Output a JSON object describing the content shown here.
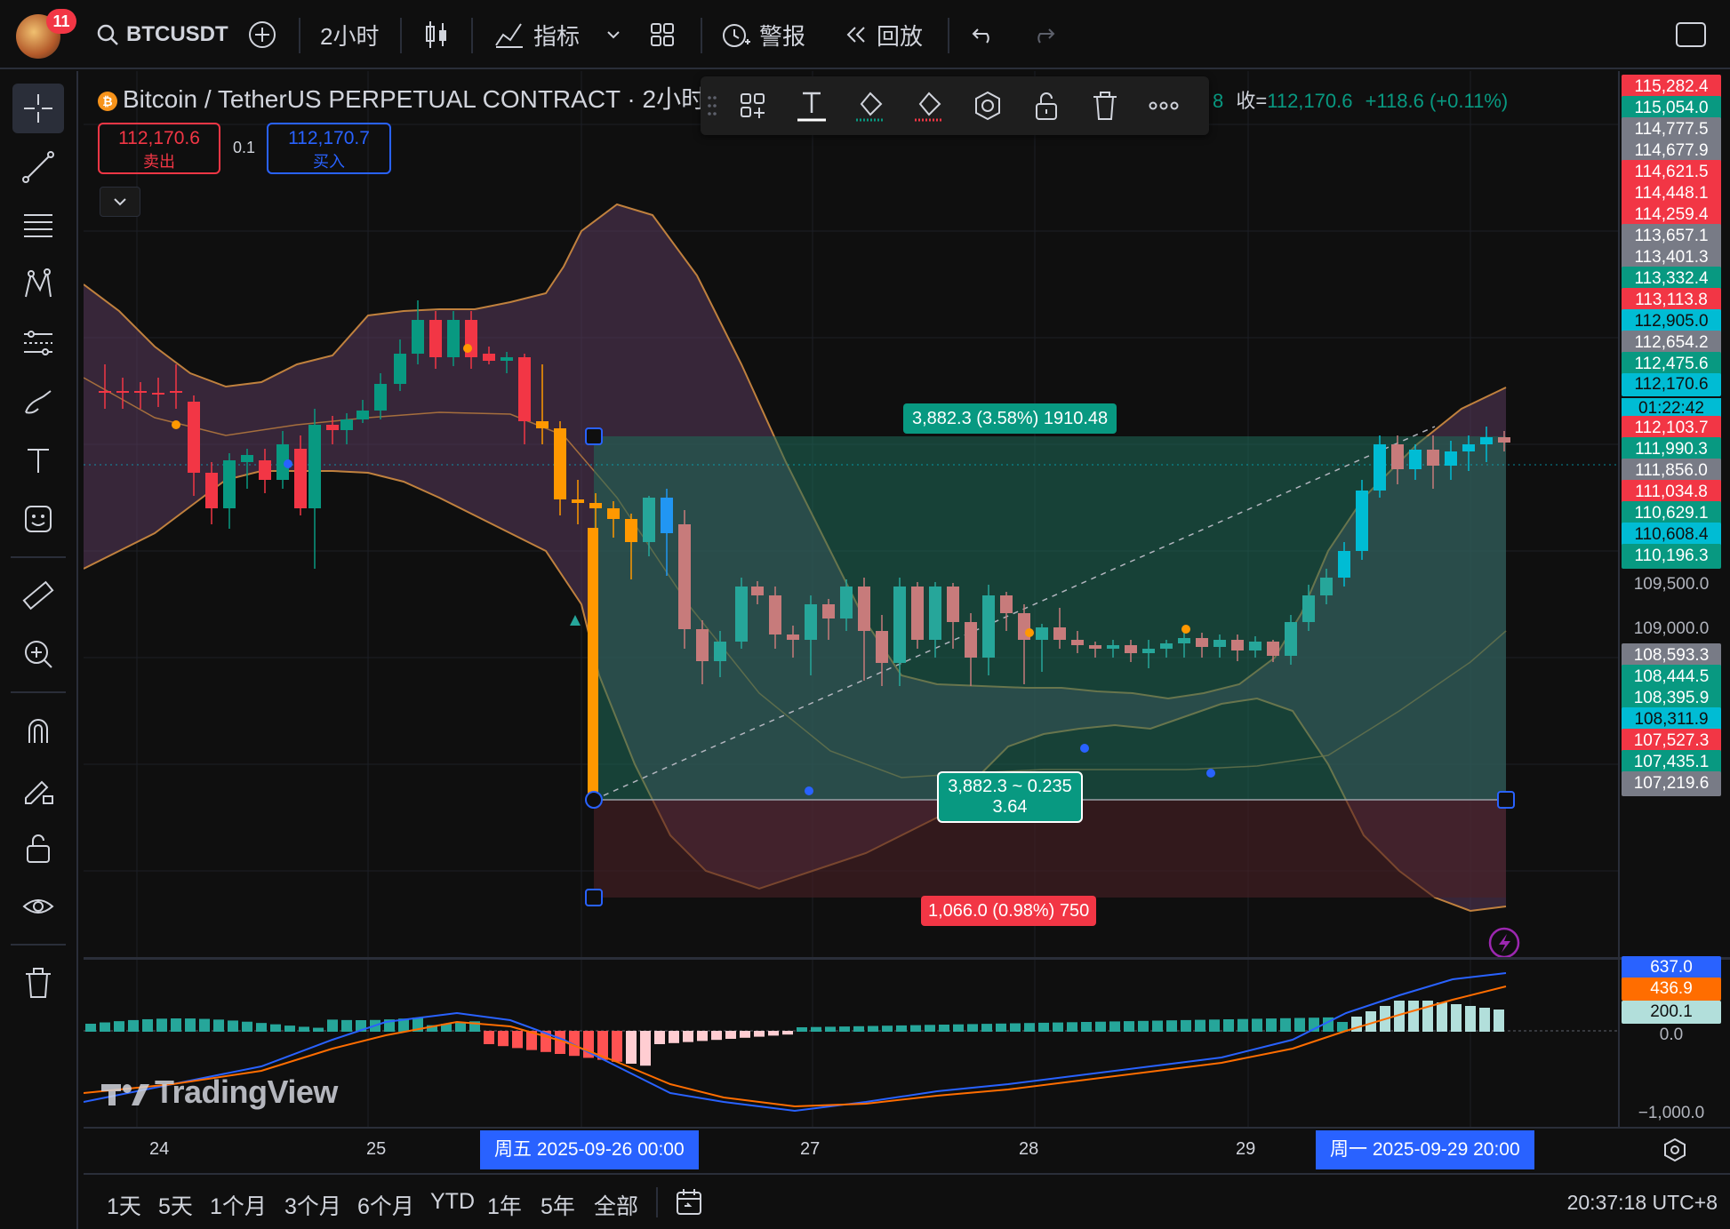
{
  "topbar": {
    "avatar_badge": "11",
    "symbol": "BTCUSDT",
    "interval": "2小时",
    "indicators": "指标",
    "alerts": "警报",
    "replay": "回放"
  },
  "header": {
    "title": "Bitcoin / TetherUS PERPETUAL CONTRACT · 2小时 ·",
    "btc_glyph": "₿",
    "sell_price": "112,170.6",
    "sell_label": "卖出",
    "spread": "0.1",
    "buy_price": "112,170.7",
    "buy_label": "买入",
    "ohlc_prefix": "8",
    "close_key": "收=",
    "close_value": "112,170.6",
    "change": "+118.6 (+0.11%)"
  },
  "position": {
    "target_label": "3,882.3 (3.58%) 1910.48",
    "center_label_line1": "3,882.3 ~ 0.235",
    "center_label_line2": "3.64",
    "stop_label": "1,066.0 (0.98%) 750"
  },
  "price_axis": [
    {
      "text": "115,282.4",
      "style": "red"
    },
    {
      "text": "115,054.0",
      "style": "green"
    },
    {
      "text": "114,777.5",
      "style": "gray"
    },
    {
      "text": "114,677.9",
      "style": "gray"
    },
    {
      "text": "114,621.5",
      "style": "red"
    },
    {
      "text": "114,448.1",
      "style": "red"
    },
    {
      "text": "114,259.4",
      "style": "red"
    },
    {
      "text": "113,657.1",
      "style": "gray"
    },
    {
      "text": "113,401.3",
      "style": "gray"
    },
    {
      "text": "113,332.4",
      "style": "green"
    },
    {
      "text": "113,113.8",
      "style": "red"
    },
    {
      "text": "112,905.0",
      "style": "cyan"
    },
    {
      "text": "112,654.2",
      "style": "gray"
    },
    {
      "text": "112,475.6",
      "style": "green"
    },
    {
      "text": "112,170.6",
      "style": "cyan"
    },
    {
      "text": "01:22:42",
      "style": "cyan"
    },
    {
      "text": "112,103.7",
      "style": "red"
    },
    {
      "text": "111,990.3",
      "style": "green"
    },
    {
      "text": "111,856.0",
      "style": "gray"
    },
    {
      "text": "111,034.8",
      "style": "red"
    },
    {
      "text": "110,629.1",
      "style": "green"
    },
    {
      "text": "110,608.4",
      "style": "cyan"
    },
    {
      "text": "110,196.3",
      "style": "green"
    },
    {
      "text": "109,500.0",
      "style": "plain"
    },
    {
      "text": "109,000.0",
      "style": "plain"
    },
    {
      "text": "108,593.3",
      "style": "gray"
    },
    {
      "text": "108,444.5",
      "style": "green"
    },
    {
      "text": "108,395.9",
      "style": "green"
    },
    {
      "text": "108,311.9",
      "style": "cyan"
    },
    {
      "text": "107,527.3",
      "style": "red"
    },
    {
      "text": "107,435.1",
      "style": "green"
    },
    {
      "text": "107,219.6",
      "style": "gray"
    }
  ],
  "macd_axis": [
    {
      "text": "637.0",
      "style": "blue"
    },
    {
      "text": "436.9",
      "style": "orange"
    },
    {
      "text": "200.1",
      "style": "mint"
    },
    {
      "text": "0.0",
      "style": "plain"
    },
    {
      "text": "−1,000.0",
      "style": "plain"
    }
  ],
  "time_axis": {
    "labels": [
      "24",
      "25",
      "27",
      "28",
      "29"
    ],
    "chip_start": "周五 2025-09-26   00:00",
    "chip_end": "周一 2025-09-29   20:00"
  },
  "range_bar": {
    "items": [
      "1天",
      "5天",
      "1个月",
      "3个月",
      "6个月",
      "YTD",
      "1年",
      "5年",
      "全部"
    ],
    "clock": "20:37:18 UTC+8"
  },
  "watermark": "TradingView",
  "colors": {
    "up": "#089981",
    "down": "#f23645",
    "target_fill": "#1f5a4d",
    "stop_fill": "#3a1d20",
    "bollinger": "#c0813e",
    "macd_line": "#2962ff",
    "signal_line": "#ff6d00"
  }
}
